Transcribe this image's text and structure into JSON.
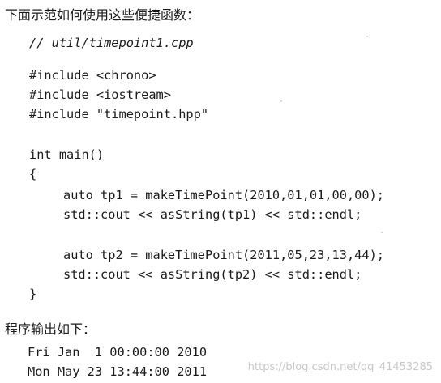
{
  "intro_text": "下面示范如何使用这些便捷函数：",
  "code": {
    "comment": "// util/timepoint1.cpp",
    "includes": [
      "#include <chrono>",
      "#include <iostream>",
      "#include \"timepoint.hpp\""
    ],
    "main_sig": "int main()",
    "open_brace": "{",
    "body_lines": [
      "auto tp1 = makeTimePoint(2010,01,01,00,00);",
      "std::cout << asString(tp1) << std::endl;",
      "auto tp2 = makeTimePoint(2011,05,23,13,44);",
      "std::cout << asString(tp2) << std::endl;"
    ],
    "close_brace": "}"
  },
  "output_heading": "程序输出如下：",
  "output_lines": [
    "Fri Jan  1 00:00:00 2010",
    "Mon May 23 13:44:00 2011"
  ],
  "watermark": "https://blog.csdn.net/qq_41453285"
}
